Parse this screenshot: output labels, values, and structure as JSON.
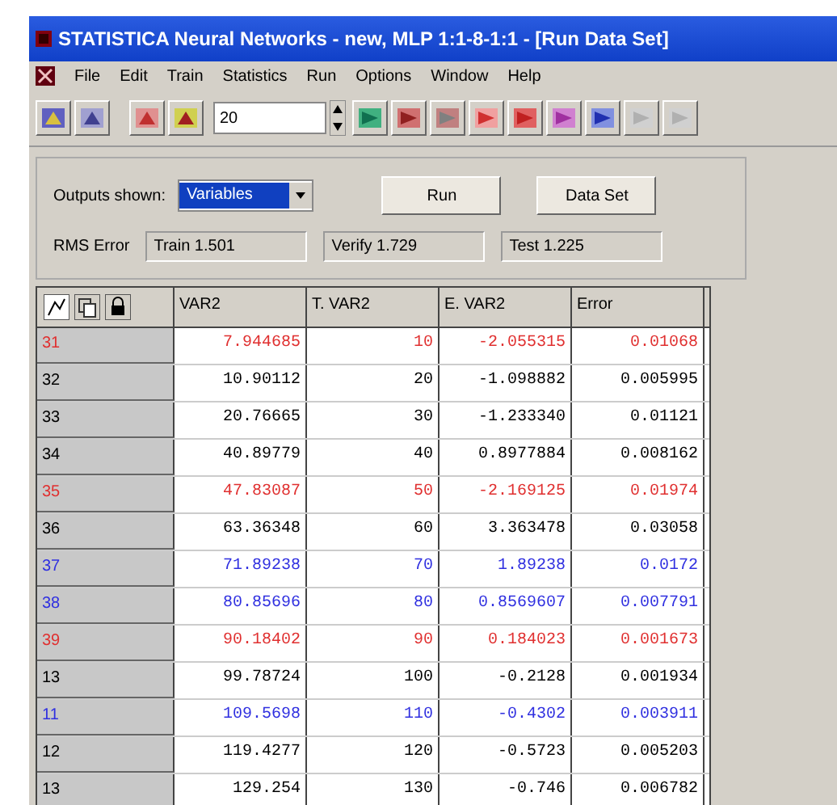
{
  "window": {
    "title": "STATISTICA Neural Networks - new, MLP 1:1-8-1:1 - [Run Data Set]"
  },
  "menu": [
    "File",
    "Edit",
    "Train",
    "Statistics",
    "Run",
    "Options",
    "Window",
    "Help"
  ],
  "toolbar": {
    "spin_value": "20"
  },
  "form": {
    "outputs_label": "Outputs shown:",
    "outputs_value": "Variables",
    "run_button": "Run",
    "data_set_button": "Data Set",
    "rms_label": "RMS Error",
    "train": "Train 1.501",
    "verify": "Verify 1.729",
    "test": "Test 1.225"
  },
  "table": {
    "columns": [
      "VAR2",
      "T. VAR2",
      "E. VAR2",
      "Error"
    ],
    "rows": [
      {
        "label": "31",
        "cells": [
          "7.944685",
          "10",
          "-2.055315",
          "0.01068"
        ],
        "color": "#e03030"
      },
      {
        "label": "32",
        "cells": [
          "10.90112",
          "20",
          "-1.098882",
          "0.005995"
        ],
        "color": "#000000"
      },
      {
        "label": "33",
        "cells": [
          "20.76665",
          "30",
          "-1.233340",
          "0.01121"
        ],
        "color": "#000000"
      },
      {
        "label": "34",
        "cells": [
          "40.89779",
          "40",
          "0.8977884",
          "0.008162"
        ],
        "color": "#000000"
      },
      {
        "label": "35",
        "cells": [
          "47.83087",
          "50",
          "-2.169125",
          "0.01974"
        ],
        "color": "#e03030"
      },
      {
        "label": "36",
        "cells": [
          "63.36348",
          "60",
          "3.363478",
          "0.03058"
        ],
        "color": "#000000"
      },
      {
        "label": "37",
        "cells": [
          "71.89238",
          "70",
          "1.89238",
          "0.0172"
        ],
        "color": "#3030e0"
      },
      {
        "label": "38",
        "cells": [
          "80.85696",
          "80",
          "0.8569607",
          "0.007791"
        ],
        "color": "#3030e0"
      },
      {
        "label": "39",
        "cells": [
          "90.18402",
          "90",
          "0.184023",
          "0.001673"
        ],
        "color": "#e03030"
      },
      {
        "label": "13",
        "cells": [
          "99.78724",
          "100",
          "-0.2128",
          "0.001934"
        ],
        "color": "#000000"
      },
      {
        "label": "11",
        "cells": [
          "109.5698",
          "110",
          "-0.4302",
          "0.003911"
        ],
        "color": "#3030e0"
      },
      {
        "label": "12",
        "cells": [
          "119.4277",
          "120",
          "-0.5723",
          "0.005203"
        ],
        "color": "#000000"
      },
      {
        "label": "13",
        "cells": [
          "129.254",
          "130",
          "-0.746",
          "0.006782"
        ],
        "color": "#000000"
      }
    ]
  }
}
